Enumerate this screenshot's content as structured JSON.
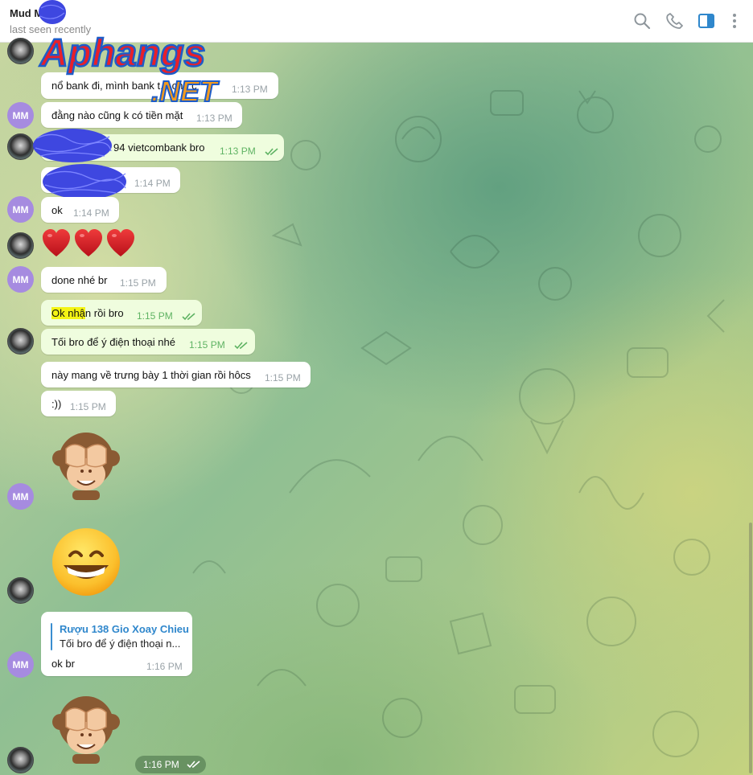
{
  "header": {
    "name": "Mud M",
    "status": "last seen recently",
    "icons": [
      "search-icon",
      "phone-icon",
      "sidebar-toggle-icon",
      "more-icon"
    ],
    "accent": "#2f87cc"
  },
  "watermark": {
    "brand_main": "Aphangs",
    "brand_sub": ".NET",
    "colors": {
      "main": "#e8202a",
      "sub": "#f39a1c",
      "outline": "#1e5cc8"
    }
  },
  "avatar_initials": "MM",
  "messages": [
    {
      "id": "m1",
      "text": "nổ bank đi, mình bank t... cho c",
      "time": "1:13 PM"
    },
    {
      "id": "m2",
      "text": "đằng nào cũng k có tiền mặt",
      "time": "1:13 PM"
    },
    {
      "id": "m3",
      "text": "94 vietcombank bro",
      "time": "1:13 PM",
      "outgoing": true,
      "read": true
    },
    {
      "id": "m4",
      "text": "",
      "time": "1:14 PM"
    },
    {
      "id": "m5",
      "text": "ok",
      "time": "1:14 PM"
    },
    {
      "id": "m6",
      "text": "❤️❤️❤️"
    },
    {
      "id": "m7",
      "text": "done nhé br",
      "time": "1:15 PM"
    },
    {
      "id": "m8",
      "text_highlight": "Ok nhậ",
      "text_rest": "n rồi bro",
      "time": "1:15 PM",
      "outgoing": true,
      "read": true
    },
    {
      "id": "m9",
      "text": "Tối bro để ý điện thoại nhé",
      "time": "1:15 PM",
      "outgoing": true,
      "read": true
    },
    {
      "id": "m10",
      "text": "này mang về trưng bày 1 thời gian rồi hôcs",
      "time": "1:15 PM"
    },
    {
      "id": "m11",
      "text": ":))",
      "time": "1:15 PM"
    },
    {
      "id": "m12",
      "emoji": "🙈"
    },
    {
      "id": "m13",
      "emoji": "😁"
    },
    {
      "id": "m14",
      "reply_author": "Rượu 138 Gio Xoay Chieu",
      "reply_text": "Tối bro để ý điện thoại n...",
      "text": "ok br",
      "time": "1:16 PM"
    },
    {
      "id": "m15",
      "emoji": "🙈",
      "time": "1:16 PM",
      "read": true
    }
  ]
}
